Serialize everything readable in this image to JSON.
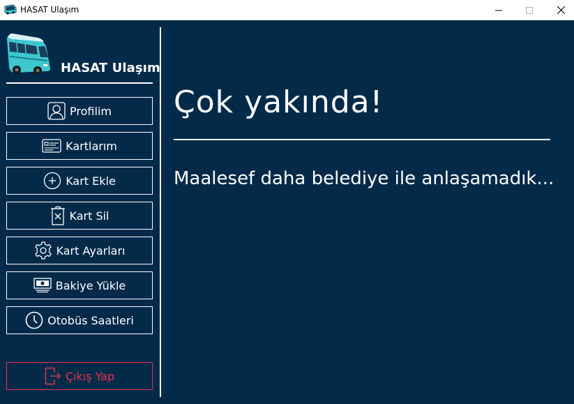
{
  "window": {
    "title": "HASAT Ulaşım"
  },
  "sidebar": {
    "brand": "HASAT Ulaşım",
    "items": [
      {
        "label": "Profilim",
        "icon": "user-icon"
      },
      {
        "label": "Kartlarım",
        "icon": "id-card-icon"
      },
      {
        "label": "Kart Ekle",
        "icon": "plus-circle-icon"
      },
      {
        "label": "Kart Sil",
        "icon": "trash-icon"
      },
      {
        "label": "Kart Ayarları",
        "icon": "gear-icon"
      },
      {
        "label": "Bakiye Yükle",
        "icon": "money-icon"
      },
      {
        "label": "Otobüs Saatleri",
        "icon": "clock-icon"
      }
    ],
    "logout": {
      "label": "Çıkış Yap",
      "icon": "logout-icon"
    }
  },
  "main": {
    "headline": "Çok yakında!",
    "message": "Maalesef daha belediye ile anlaşamadık..."
  },
  "colors": {
    "background": "#042a4a",
    "foreground": "#ffffff",
    "logout": "#e8334a",
    "bus": "#3ec7cf"
  }
}
